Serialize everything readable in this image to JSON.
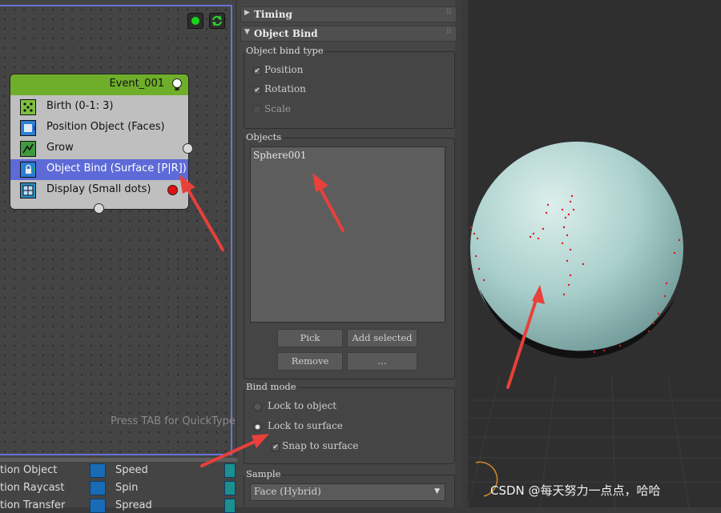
{
  "particle_view": {
    "event": {
      "title": "Event_001"
    },
    "operators": [
      {
        "label": "Birth (0-1: 3)",
        "icon": "birth-icon"
      },
      {
        "label": "Position Object (Faces)",
        "icon": "position-object-icon"
      },
      {
        "label": "Grow",
        "icon": "grow-icon"
      },
      {
        "label": "Object Bind (Surface [P|R])",
        "icon": "object-bind-icon"
      },
      {
        "label": "Display (Small dots)",
        "icon": "display-icon"
      }
    ],
    "hint": "Press TAB for QuickType",
    "depot": {
      "left": [
        "tion Object",
        "tion Raycast",
        "tion Transfer"
      ],
      "right": [
        "Speed",
        "Spin",
        "Spread"
      ]
    }
  },
  "rollouts": {
    "timing": {
      "title": "Timing"
    },
    "object_bind": {
      "title": "Object Bind",
      "bind_type": {
        "title": "Object bind type",
        "position": {
          "label": "Position",
          "checked": true
        },
        "rotation": {
          "label": "Rotation",
          "checked": true
        },
        "scale": {
          "label": "Scale",
          "checked": false
        }
      },
      "objects": {
        "title": "Objects",
        "items": [
          "Sphere001"
        ]
      },
      "buttons": {
        "pick": "Pick",
        "add_selected": "Add selected",
        "remove": "Remove",
        "more": "..."
      },
      "bind_mode": {
        "title": "Bind mode",
        "lock_to_object": "Lock to object",
        "lock_to_surface": "Lock to surface",
        "selected": "lock_to_surface",
        "snap_to_surface": {
          "label": "Snap to surface",
          "checked": true
        }
      },
      "sample": {
        "title": "Sample",
        "value": "Face (Hybrid)"
      }
    }
  },
  "watermark": "CSDN @每天努力一点点，哈哈",
  "colors": {
    "event_header": "#6fae2b",
    "selection": "#5d6ad7",
    "graph_frame": "#6a72d9",
    "arrow": "#e8403a",
    "sphere": "#a9cfcc",
    "particles": "#e01515"
  }
}
